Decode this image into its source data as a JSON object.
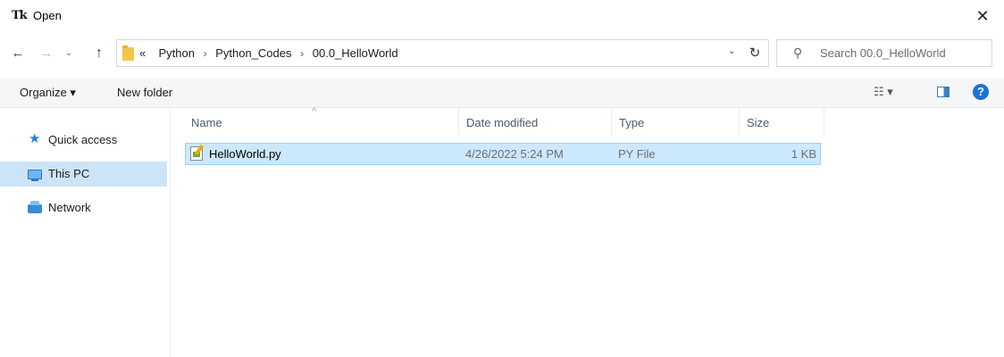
{
  "window": {
    "app_icon": "Tk",
    "title": "Open",
    "close_label": "✕"
  },
  "nav": {
    "back": "←",
    "forward": "→",
    "recent": "⌄",
    "up": "↑"
  },
  "address": {
    "prefix": "«",
    "crumbs": [
      "Python",
      "Python_Codes",
      "00.0_HelloWorld"
    ],
    "separator": "›",
    "dropdown": "⌄",
    "refresh": "↻"
  },
  "search": {
    "icon": "search-icon",
    "placeholder": "Search 00.0_HelloWorld"
  },
  "toolbar": {
    "organize": "Organize ▾",
    "new_folder": "New folder",
    "view": "☷ ▾",
    "help": "?"
  },
  "sidebar": {
    "items": [
      {
        "label": "Quick access",
        "icon": "star-icon",
        "selected": false
      },
      {
        "label": "This PC",
        "icon": "computer-icon",
        "selected": true
      },
      {
        "label": "Network",
        "icon": "network-icon",
        "selected": false
      }
    ]
  },
  "columns": {
    "name": "Name",
    "date": "Date modified",
    "type": "Type",
    "size": "Size",
    "sort_indicator": "^"
  },
  "files": [
    {
      "name": "HelloWorld.py",
      "date": "4/26/2022 5:24 PM",
      "type": "PY File",
      "size": "1 KB",
      "selected": true
    }
  ],
  "colors": {
    "selection": "#cce8ff",
    "nav_selection": "#cce4f7",
    "accent": "#1a73d9"
  }
}
